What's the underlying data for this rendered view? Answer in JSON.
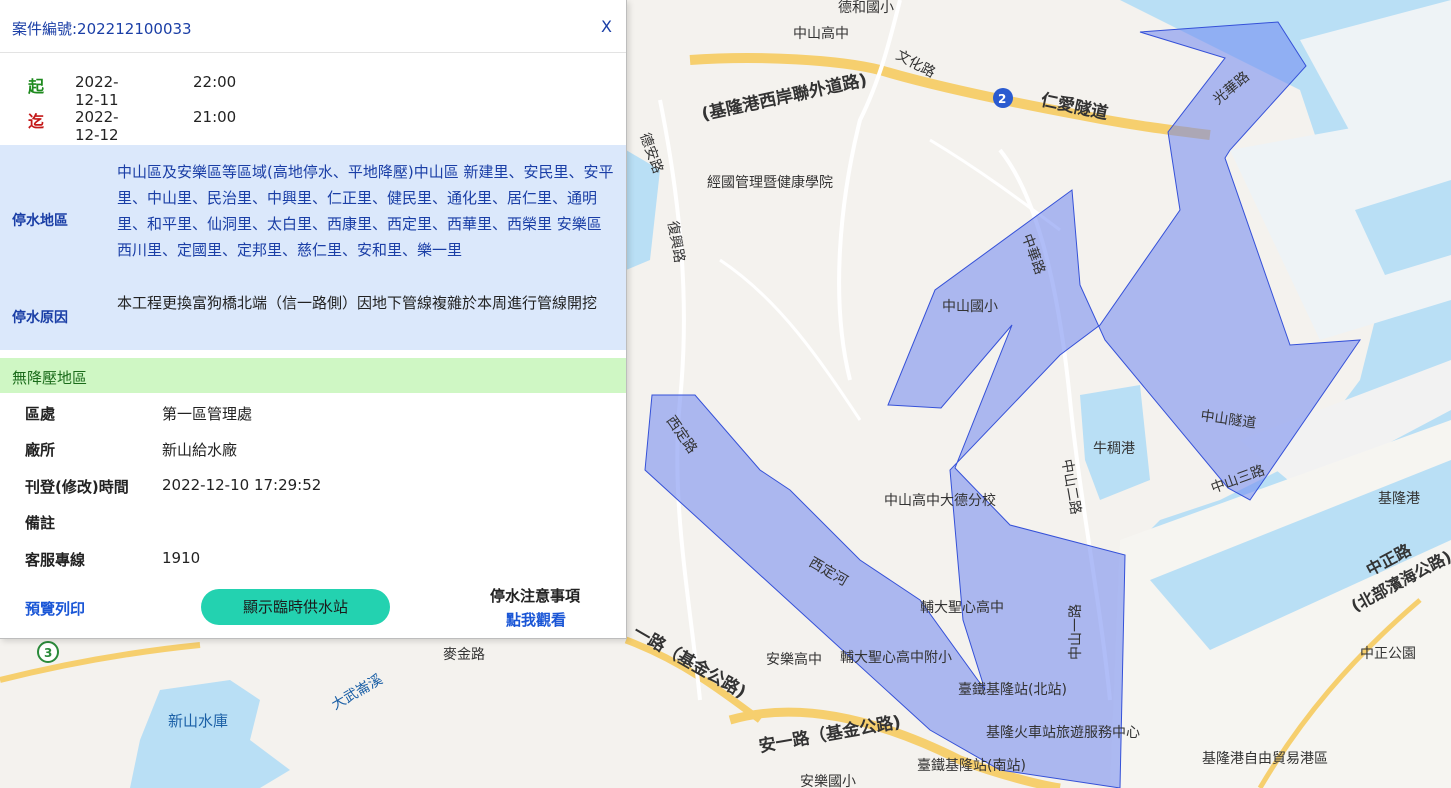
{
  "panel": {
    "case_title": "案件編號:202212100033",
    "close_label": "X",
    "start": {
      "label": "起",
      "date": "2022-12-11",
      "time": "22:00",
      "color": "#1e8a1e"
    },
    "end": {
      "label": "迄",
      "date": "2022-12-12",
      "time": "21:00",
      "color": "#c41818"
    },
    "area_label": "停水地區",
    "area_text": "中山區及安樂區等區域(高地停水、平地降壓)中山區 新建里、安民里、安平里、中山里、民治里、中興里、仁正里、健民里、通化里、居仁里、通明里、和平里、仙洞里、太白里、西康里、西定里、西華里、西榮里 安樂區 西川里、定國里、定邦里、慈仁里、安和里、樂一里",
    "reason_label": "停水原因",
    "reason_text": "本工程更換富狗橋北端（信一路側）因地下管線複雜於本周進行管線開挖",
    "no_pressure_label": "無降壓地區",
    "rows": [
      {
        "key": "區處",
        "value": "第一區管理處"
      },
      {
        "key": "廠所",
        "value": "新山給水廠"
      },
      {
        "key": "刊登(修改)時間",
        "value": "2022-12-10 17:29:52"
      },
      {
        "key": "備註",
        "value": ""
      },
      {
        "key": "客服專線",
        "value": "1910"
      }
    ],
    "print_label": "預覽列印",
    "station_button": "顯示臨時供水站",
    "notice_title": "停水注意事項",
    "notice_link": "點我觀看",
    "accent": "#1a3ea6",
    "button_color": "#23d2b0"
  },
  "map": {
    "labels": [
      "德和國小",
      "中山高中",
      "文化路",
      "(基隆港西岸聯外道路)",
      "仁愛隧道",
      "光華路",
      "德安路",
      "經國管理暨健康學院",
      "復興路",
      "中華路",
      "中山國小",
      "牛稠港",
      "中山隧道",
      "中山三路",
      "基隆港",
      "中山高中大德分校",
      "西定路",
      "西定河",
      "輔大聖心高中",
      "安樂高中",
      "輔大聖心高中附小",
      "臺鐵基隆站(北站)",
      "基隆火車站旅遊服務中心",
      "臺鐵基隆站(南站)",
      "安一路（基金公路)",
      "一路（基金公路)",
      "中正路",
      "(北部濱海公路)",
      "中正公園",
      "基隆港自由貿易港區",
      "新山水庫",
      "大武崙溪",
      "麥金路",
      "中山一路",
      "中山二路",
      "安樂國小"
    ],
    "route_badges": [
      "2",
      "3"
    ],
    "polygon_color": "#6f86f0"
  }
}
